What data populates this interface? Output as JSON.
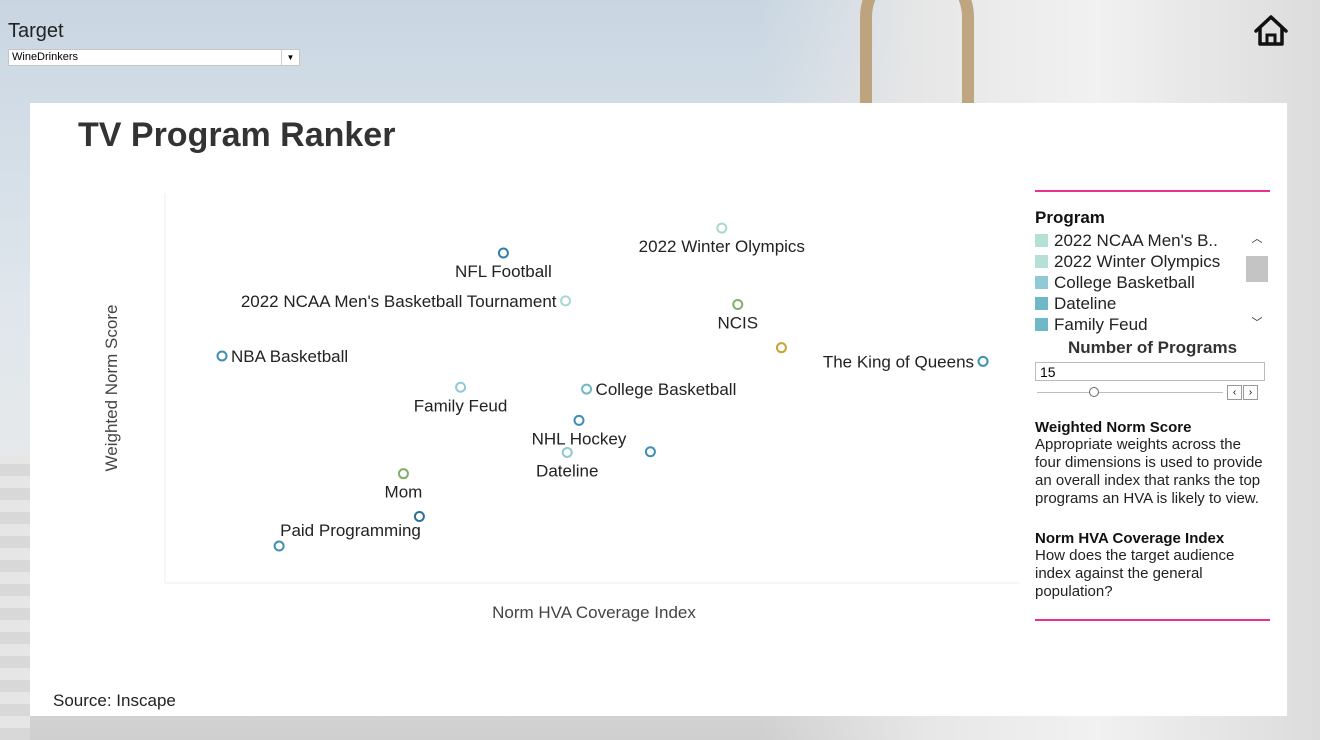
{
  "target": {
    "label": "Target",
    "selected": "WineDrinkers"
  },
  "header": {
    "title": "TV Program Ranker"
  },
  "source": "Source: Inscape",
  "sidebar": {
    "program_title": "Program",
    "programs": [
      {
        "label": "2022 NCAA Men's B..",
        "color": "#b4e0d6"
      },
      {
        "label": "2022 Winter Olympics",
        "color": "#b4e0d6"
      },
      {
        "label": "College Basketball",
        "color": "#8fcad5"
      },
      {
        "label": "Dateline",
        "color": "#6fb8c8"
      },
      {
        "label": "Family Feud",
        "color": "#6fb8c8"
      }
    ],
    "num_title": "Number of Programs",
    "num_value": "15",
    "score_title": "Weighted Norm Score",
    "score_desc": "Appropriate weights across the four dimensions is used to provide an overall index that ranks the top programs an HVA is likely to view.",
    "index_title": "Norm HVA Coverage Index",
    "index_desc": "How does the target audience index against the general population?"
  },
  "chart_data": {
    "type": "scatter",
    "xlabel": "Norm HVA Coverage Index",
    "ylabel": "Weighted Norm Score",
    "xlim": [
      0,
      100
    ],
    "ylim": [
      0,
      100
    ],
    "points": [
      {
        "name": "2022 Winter Olympics",
        "x": 64.5,
        "y": 94.4,
        "color": "#a8d8d0",
        "label_pos": "below"
      },
      {
        "name": "NFL Football",
        "x": 38.5,
        "y": 87.5,
        "color": "#2f7fa6",
        "label_pos": "below"
      },
      {
        "name": "2022 NCAA Men's Basketball Tournament",
        "x": 45.9,
        "y": 74.2,
        "color": "#a8d8d0",
        "label_pos": "left"
      },
      {
        "name": "NCIS",
        "x": 66.4,
        "y": 73.2,
        "color": "#7fb069",
        "label_pos": "below"
      },
      {
        "name": "",
        "x": 71.6,
        "y": 61.2,
        "color": "#c8a437",
        "label_pos": "none"
      },
      {
        "name": "NBA Basketball",
        "x": 5.0,
        "y": 58.9,
        "color": "#3f8fb2",
        "label_pos": "right"
      },
      {
        "name": "The King of Queens",
        "x": 95.6,
        "y": 57.4,
        "color": "#3f8fb2",
        "label_pos": "left"
      },
      {
        "name": "Family Feud",
        "x": 33.4,
        "y": 50.2,
        "color": "#8fcad5",
        "label_pos": "below"
      },
      {
        "name": "College Basketball",
        "x": 48.4,
        "y": 49.7,
        "color": "#6fb8c8",
        "label_pos": "right"
      },
      {
        "name": "NHL Hockey",
        "x": 47.5,
        "y": 41.0,
        "color": "#3f8fb2",
        "label_pos": "below"
      },
      {
        "name": "Dateline",
        "x": 46.1,
        "y": 32.1,
        "color": "#8fcad5",
        "label_pos": "below"
      },
      {
        "name": "",
        "x": 56.0,
        "y": 32.3,
        "color": "#3f8fb2",
        "label_pos": "none"
      },
      {
        "name": "Mom",
        "x": 26.6,
        "y": 26.2,
        "color": "#7fb069",
        "label_pos": "below"
      },
      {
        "name": "",
        "x": 28.5,
        "y": 14.3,
        "color": "#2f6f95",
        "label_pos": "none"
      },
      {
        "name": "Paid Programming",
        "x": 11.8,
        "y": 6.1,
        "color": "#3f8fb2",
        "label_pos": "above-right"
      }
    ]
  }
}
